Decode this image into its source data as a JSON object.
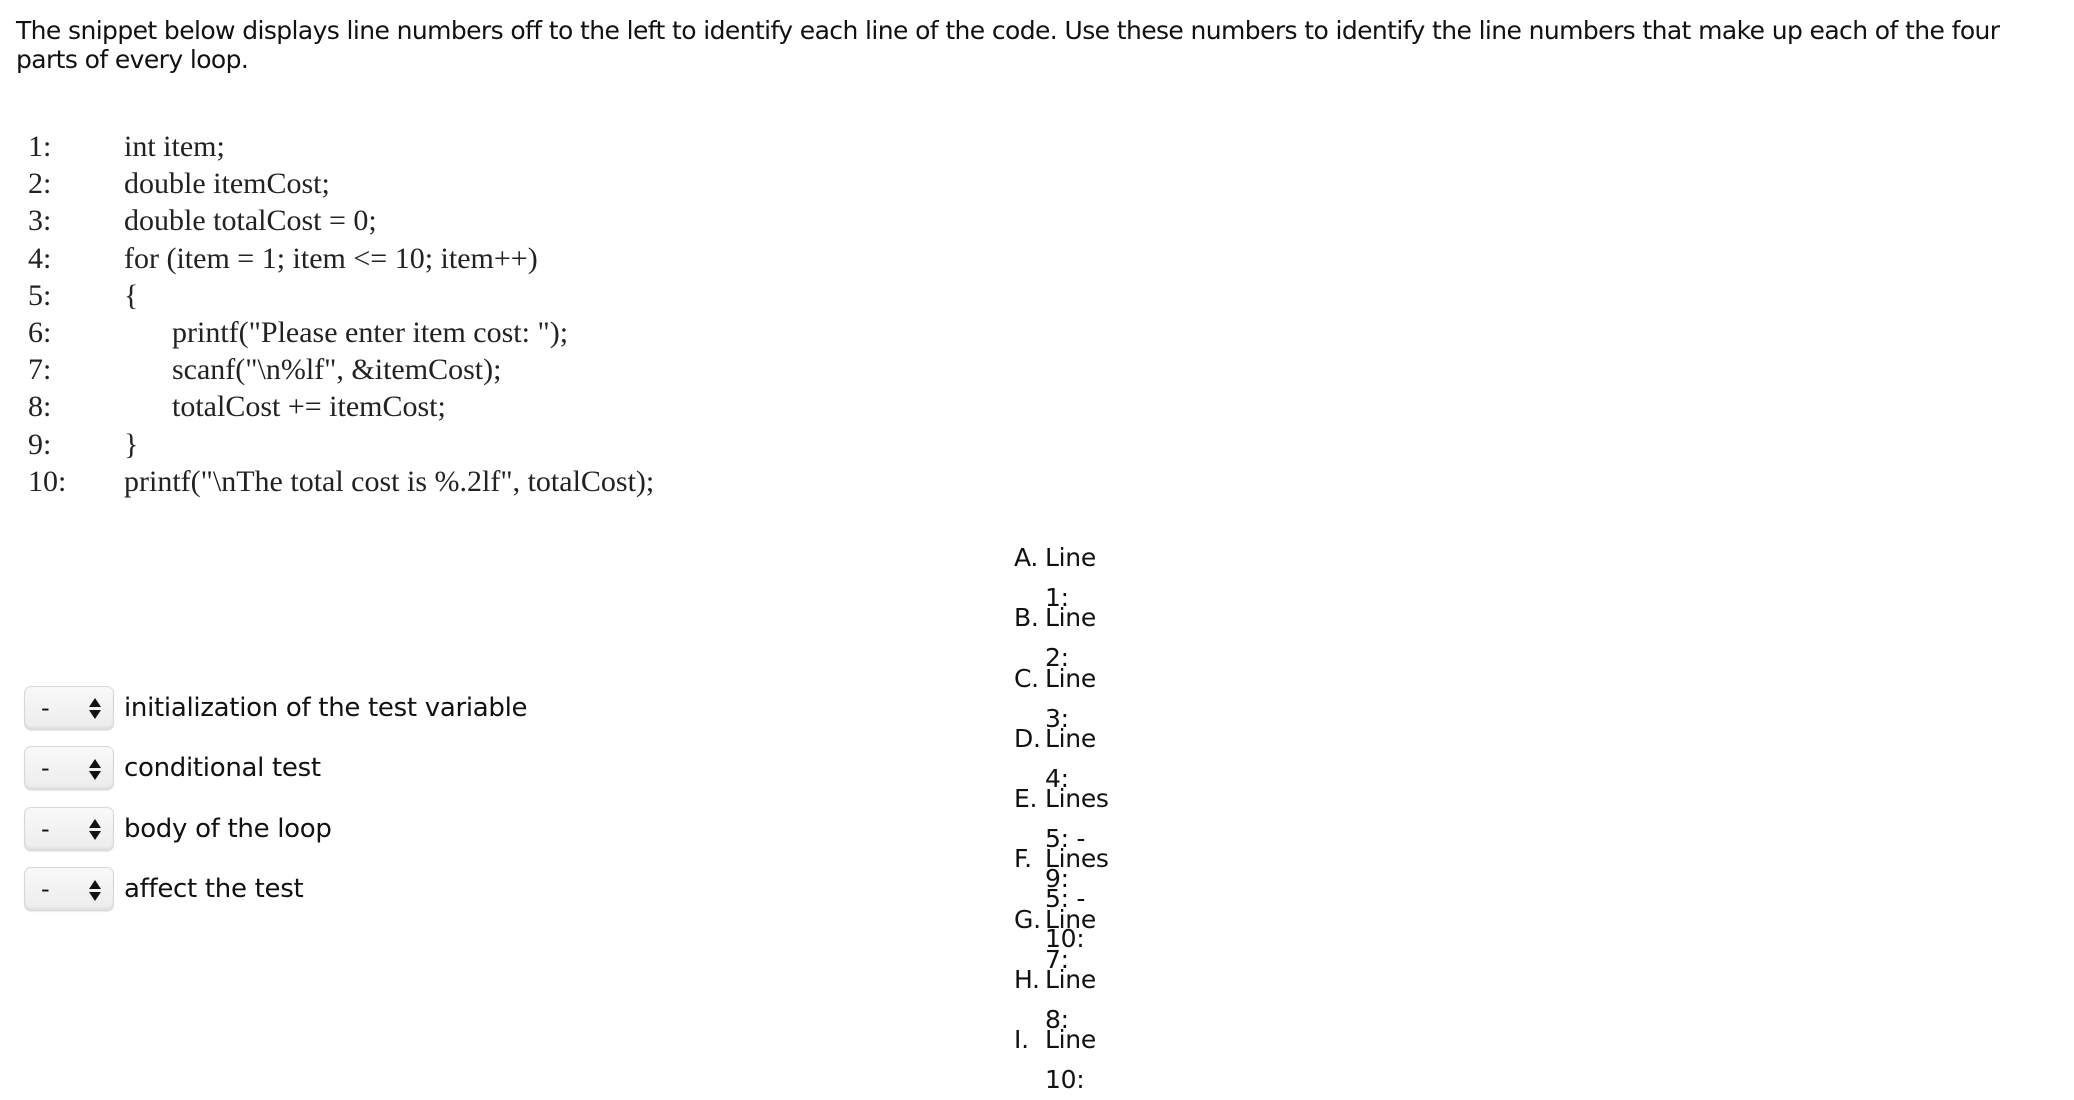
{
  "instructions": "The snippet below displays line numbers off to the left to identify each line of the code.  Use these numbers to identify the line numbers that make up each of the four parts of every loop.",
  "code": [
    {
      "no": "1:",
      "text": "int item;",
      "indent": false
    },
    {
      "no": "2:",
      "text": "double itemCost;",
      "indent": false
    },
    {
      "no": "3:",
      "text": "double totalCost = 0;",
      "indent": false
    },
    {
      "no": "4:",
      "text": "for (item = 1; item <= 10; item++)",
      "indent": false
    },
    {
      "no": "5:",
      "text": "{",
      "indent": false
    },
    {
      "no": "6:",
      "text": "printf(\"Please enter item cost: \");",
      "indent": true
    },
    {
      "no": "7:",
      "text": "scanf(\"\\n%lf\", &itemCost);",
      "indent": true
    },
    {
      "no": "8:",
      "text": "totalCost += itemCost;",
      "indent": true
    },
    {
      "no": "9:",
      "text": "}",
      "indent": false
    },
    {
      "no": "10:",
      "text": "printf(\"\\nThe total cost is %.2lf\", totalCost);",
      "indent": false
    }
  ],
  "matches": [
    {
      "selected": "-",
      "label": "initialization of the test variable"
    },
    {
      "selected": "-",
      "label": "conditional test"
    },
    {
      "selected": "-",
      "label": "body of the loop"
    },
    {
      "selected": "-",
      "label": "affect the test"
    }
  ],
  "options": [
    {
      "letter": "A.",
      "text": "Line 1:"
    },
    {
      "letter": "B.",
      "text": "Line 2:"
    },
    {
      "letter": "C.",
      "text": "Line 3:"
    },
    {
      "letter": "D.",
      "text": "Line 4:"
    },
    {
      "letter": "E.",
      "text": "Lines 5: - 9:"
    },
    {
      "letter": "F.",
      "text": "Lines 5: - 10:"
    },
    {
      "letter": "G.",
      "text": "Line 7:"
    },
    {
      "letter": "H.",
      "text": "Line 8:"
    },
    {
      "letter": "I.",
      "text": "Line 10:"
    }
  ],
  "icons": {
    "select_arrows": "up-down-arrows-icon"
  }
}
